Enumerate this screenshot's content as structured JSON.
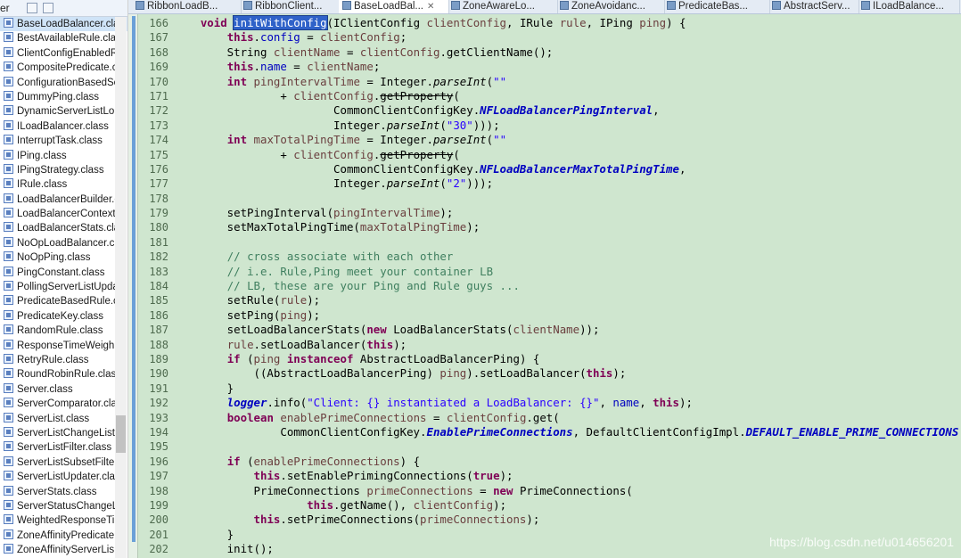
{
  "explorer": {
    "header_label": "er",
    "items": [
      "BaseLoadBalancer.cla",
      "BestAvailableRule.cla",
      "ClientConfigEnabledR",
      "CompositePredicate.c",
      "ConfigurationBasedSe",
      "DummyPing.class",
      "DynamicServerListLo",
      "ILoadBalancer.class",
      "InterruptTask.class",
      "IPing.class",
      "IPingStrategy.class",
      "IRule.class",
      "LoadBalancerBuilder.c",
      "LoadBalancerContext",
      "LoadBalancerStats.cla",
      "NoOpLoadBalancer.cl",
      "NoOpPing.class",
      "PingConstant.class",
      "PollingServerListUpda",
      "PredicateBasedRule.c",
      "PredicateKey.class",
      "RandomRule.class",
      "ResponseTimeWeigh",
      "RetryRule.class",
      "RoundRobinRule.clas",
      "Server.class",
      "ServerComparator.cla",
      "ServerList.class",
      "ServerListChangeListe",
      "ServerListFilter.class",
      "ServerListSubsetFilte",
      "ServerListUpdater.cla",
      "ServerStats.class",
      "ServerStatusChangeL",
      "WeightedResponseTi",
      "ZoneAffinityPredicate",
      "ZoneAffinityServerLis"
    ]
  },
  "tabs": [
    {
      "label": "RibbonLoadB..."
    },
    {
      "label": "RibbonClient..."
    },
    {
      "label": "BaseLoadBal..."
    },
    {
      "label": "ZoneAwareLo..."
    },
    {
      "label": "ZoneAvoidanc..."
    },
    {
      "label": "PredicateBas..."
    },
    {
      "label": "AbstractServ..."
    },
    {
      "label": "ILoadBalance..."
    }
  ],
  "editor": {
    "lines": [
      {
        "n": "166",
        "tokens": [
          [
            "",
            "    "
          ],
          [
            "kw",
            "void"
          ],
          [
            "",
            " "
          ],
          [
            "hl",
            "initWithConfig"
          ],
          [
            "",
            "(IClientConfig "
          ],
          [
            "vr",
            "clientConfig"
          ],
          [
            "",
            ", IRule "
          ],
          [
            "vr",
            "rule"
          ],
          [
            "",
            ", IPing "
          ],
          [
            "vr",
            "ping"
          ],
          [
            "",
            ") {"
          ]
        ]
      },
      {
        "n": "167",
        "tokens": [
          [
            "",
            "        "
          ],
          [
            "kw",
            "this"
          ],
          [
            "",
            "."
          ],
          [
            "fld",
            "config"
          ],
          [
            "",
            " = "
          ],
          [
            "vr",
            "clientConfig"
          ],
          [
            "",
            ";"
          ]
        ]
      },
      {
        "n": "168",
        "tokens": [
          [
            "",
            "        String "
          ],
          [
            "vr",
            "clientName"
          ],
          [
            "",
            " = "
          ],
          [
            "vr",
            "clientConfig"
          ],
          [
            "",
            ".getClientName();"
          ]
        ]
      },
      {
        "n": "169",
        "tokens": [
          [
            "",
            "        "
          ],
          [
            "kw",
            "this"
          ],
          [
            "",
            "."
          ],
          [
            "fld",
            "name"
          ],
          [
            "",
            " = "
          ],
          [
            "vr",
            "clientName"
          ],
          [
            "",
            ";"
          ]
        ]
      },
      {
        "n": "170",
        "tokens": [
          [
            "",
            "        "
          ],
          [
            "kw",
            "int"
          ],
          [
            "",
            " "
          ],
          [
            "vr",
            "pingIntervalTime"
          ],
          [
            "",
            " = Integer."
          ],
          [
            "stat",
            "parseInt"
          ],
          [
            "",
            "("
          ],
          [
            "str",
            "\"\""
          ]
        ]
      },
      {
        "n": "171",
        "tokens": [
          [
            "",
            "                + "
          ],
          [
            "vr",
            "clientConfig"
          ],
          [
            "",
            "."
          ],
          [
            "depr",
            "getProperty"
          ],
          [
            "",
            "("
          ]
        ]
      },
      {
        "n": "172",
        "tokens": [
          [
            "",
            "                        CommonClientConfigKey."
          ],
          [
            "sfld",
            "NFLoadBalancerPingInterval"
          ],
          [
            "",
            ","
          ]
        ]
      },
      {
        "n": "173",
        "tokens": [
          [
            "",
            "                        Integer."
          ],
          [
            "stat",
            "parseInt"
          ],
          [
            "",
            "("
          ],
          [
            "str",
            "\"30\""
          ],
          [
            "",
            ")));"
          ]
        ]
      },
      {
        "n": "174",
        "tokens": [
          [
            "",
            "        "
          ],
          [
            "kw",
            "int"
          ],
          [
            "",
            " "
          ],
          [
            "vr",
            "maxTotalPingTime"
          ],
          [
            "",
            " = Integer."
          ],
          [
            "stat",
            "parseInt"
          ],
          [
            "",
            "("
          ],
          [
            "str",
            "\"\""
          ]
        ]
      },
      {
        "n": "175",
        "tokens": [
          [
            "",
            "                + "
          ],
          [
            "vr",
            "clientConfig"
          ],
          [
            "",
            "."
          ],
          [
            "depr",
            "getProperty"
          ],
          [
            "",
            "("
          ]
        ]
      },
      {
        "n": "176",
        "tokens": [
          [
            "",
            "                        CommonClientConfigKey."
          ],
          [
            "sfld",
            "NFLoadBalancerMaxTotalPingTime"
          ],
          [
            "",
            ","
          ]
        ]
      },
      {
        "n": "177",
        "tokens": [
          [
            "",
            "                        Integer."
          ],
          [
            "stat",
            "parseInt"
          ],
          [
            "",
            "("
          ],
          [
            "str",
            "\"2\""
          ],
          [
            "",
            ")));"
          ]
        ]
      },
      {
        "n": "178",
        "tokens": [
          [
            "",
            ""
          ]
        ]
      },
      {
        "n": "179",
        "tokens": [
          [
            "",
            "        setPingInterval("
          ],
          [
            "vr",
            "pingIntervalTime"
          ],
          [
            "",
            ");"
          ]
        ]
      },
      {
        "n": "180",
        "tokens": [
          [
            "",
            "        setMaxTotalPingTime("
          ],
          [
            "vr",
            "maxTotalPingTime"
          ],
          [
            "",
            ");"
          ]
        ]
      },
      {
        "n": "181",
        "tokens": [
          [
            "",
            ""
          ]
        ]
      },
      {
        "n": "182",
        "tokens": [
          [
            "",
            "        "
          ],
          [
            "cmt",
            "// cross associate with each other"
          ]
        ]
      },
      {
        "n": "183",
        "tokens": [
          [
            "",
            "        "
          ],
          [
            "cmt",
            "// i.e. Rule,Ping meet your container LB"
          ]
        ]
      },
      {
        "n": "184",
        "tokens": [
          [
            "",
            "        "
          ],
          [
            "cmt",
            "// LB, these are your Ping and Rule guys ..."
          ]
        ]
      },
      {
        "n": "185",
        "tokens": [
          [
            "",
            "        setRule("
          ],
          [
            "vr",
            "rule"
          ],
          [
            "",
            ");"
          ]
        ]
      },
      {
        "n": "186",
        "tokens": [
          [
            "",
            "        setPing("
          ],
          [
            "vr",
            "ping"
          ],
          [
            "",
            ");"
          ]
        ]
      },
      {
        "n": "187",
        "tokens": [
          [
            "",
            "        setLoadBalancerStats("
          ],
          [
            "kw",
            "new"
          ],
          [
            "",
            " LoadBalancerStats("
          ],
          [
            "vr",
            "clientName"
          ],
          [
            "",
            "));"
          ]
        ]
      },
      {
        "n": "188",
        "tokens": [
          [
            "",
            "        "
          ],
          [
            "vr",
            "rule"
          ],
          [
            "",
            ".setLoadBalancer("
          ],
          [
            "kw",
            "this"
          ],
          [
            "",
            ");"
          ]
        ]
      },
      {
        "n": "189",
        "tokens": [
          [
            "",
            "        "
          ],
          [
            "kw",
            "if"
          ],
          [
            "",
            " ("
          ],
          [
            "vr",
            "ping"
          ],
          [
            "",
            " "
          ],
          [
            "kw",
            "instanceof"
          ],
          [
            "",
            " AbstractLoadBalancerPing) {"
          ]
        ]
      },
      {
        "n": "190",
        "tokens": [
          [
            "",
            "            ((AbstractLoadBalancerPing) "
          ],
          [
            "vr",
            "ping"
          ],
          [
            "",
            ").setLoadBalancer("
          ],
          [
            "kw",
            "this"
          ],
          [
            "",
            ");"
          ]
        ]
      },
      {
        "n": "191",
        "tokens": [
          [
            "",
            "        }"
          ]
        ]
      },
      {
        "n": "192",
        "tokens": [
          [
            "",
            "        "
          ],
          [
            "sfld",
            "logger"
          ],
          [
            "",
            ".info("
          ],
          [
            "str",
            "\"Client: {} instantiated a LoadBalancer: {}\""
          ],
          [
            "",
            ", "
          ],
          [
            "fld",
            "name"
          ],
          [
            "",
            ", "
          ],
          [
            "kw",
            "this"
          ],
          [
            "",
            ");"
          ]
        ]
      },
      {
        "n": "193",
        "tokens": [
          [
            "",
            "        "
          ],
          [
            "kw",
            "boolean"
          ],
          [
            "",
            " "
          ],
          [
            "vr",
            "enablePrimeConnections"
          ],
          [
            "",
            " = "
          ],
          [
            "vr",
            "clientConfig"
          ],
          [
            "",
            ".get("
          ]
        ]
      },
      {
        "n": "194",
        "tokens": [
          [
            "",
            "                CommonClientConfigKey."
          ],
          [
            "sfld",
            "EnablePrimeConnections"
          ],
          [
            "",
            ", DefaultClientConfigImpl."
          ],
          [
            "sfld",
            "DEFAULT_ENABLE_PRIME_CONNECTIONS"
          ]
        ]
      },
      {
        "n": "195",
        "tokens": [
          [
            "",
            ""
          ]
        ]
      },
      {
        "n": "196",
        "tokens": [
          [
            "",
            "        "
          ],
          [
            "kw",
            "if"
          ],
          [
            "",
            " ("
          ],
          [
            "vr",
            "enablePrimeConnections"
          ],
          [
            "",
            ") {"
          ]
        ]
      },
      {
        "n": "197",
        "tokens": [
          [
            "",
            "            "
          ],
          [
            "kw",
            "this"
          ],
          [
            "",
            ".setEnablePrimingConnections("
          ],
          [
            "kw",
            "true"
          ],
          [
            "",
            ");"
          ]
        ]
      },
      {
        "n": "198",
        "tokens": [
          [
            "",
            "            PrimeConnections "
          ],
          [
            "vr",
            "primeConnections"
          ],
          [
            "",
            " = "
          ],
          [
            "kw",
            "new"
          ],
          [
            "",
            " PrimeConnections("
          ]
        ]
      },
      {
        "n": "199",
        "tokens": [
          [
            "",
            "                    "
          ],
          [
            "kw",
            "this"
          ],
          [
            "",
            ".getName(), "
          ],
          [
            "vr",
            "clientConfig"
          ],
          [
            "",
            ");"
          ]
        ]
      },
      {
        "n": "200",
        "tokens": [
          [
            "",
            "            "
          ],
          [
            "kw",
            "this"
          ],
          [
            "",
            ".setPrimeConnections("
          ],
          [
            "vr",
            "primeConnections"
          ],
          [
            "",
            ");"
          ]
        ]
      },
      {
        "n": "201",
        "tokens": [
          [
            "",
            "        }"
          ]
        ]
      },
      {
        "n": "202",
        "tokens": [
          [
            "",
            "        init();"
          ]
        ]
      }
    ]
  },
  "watermark": "https://blog.csdn.net/u014656201",
  "colors": {
    "editor_background": "#cfe6cf",
    "keyword": "#7f0055",
    "field": "#0000c0",
    "string": "#2a00ff",
    "comment": "#3f7f5f",
    "selection": "#2f62c9"
  }
}
